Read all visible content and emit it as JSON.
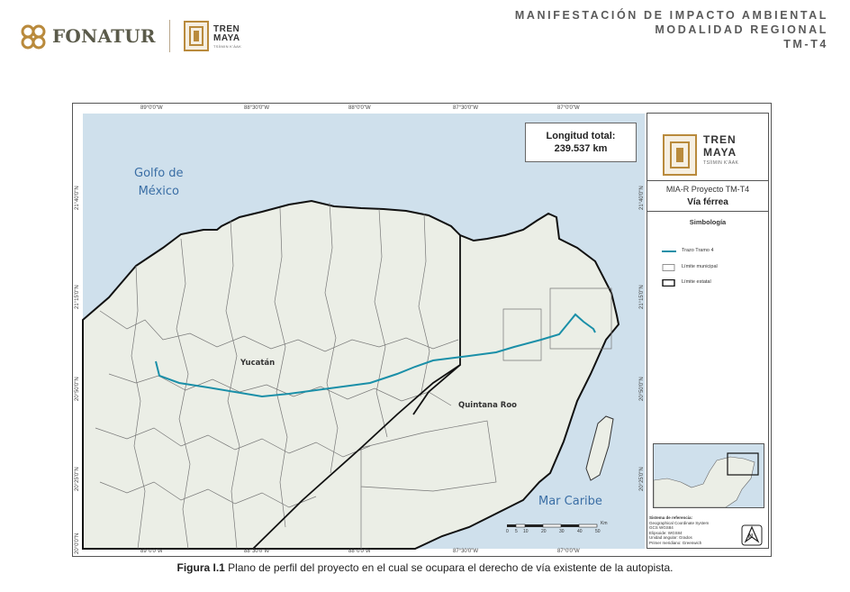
{
  "header": {
    "fonatur": "FONATUR",
    "tren_line1": "TREN",
    "tren_line2": "MAYA",
    "tren_line3": "TSÍIMIN K'ÁAK",
    "title_line1": "MANIFESTACIÓN DE IMPACTO AMBIENTAL",
    "title_line2": "MODALIDAD REGIONAL",
    "title_line3": "TM-T4"
  },
  "map": {
    "longitude_labels": [
      "89°0'0\"W",
      "88°30'0\"W",
      "88°0'0\"W",
      "87°30'0\"W",
      "87°0'0\"W"
    ],
    "latitude_labels": [
      "21°40'0\"N",
      "21°15'0\"N",
      "20°50'0\"N",
      "20°25'0\"N",
      "20°0'0\"N"
    ],
    "total_length_label": "Longitud total:",
    "total_length_value": "239.537 km",
    "gulf_line1": "Golfo de",
    "gulf_line2": "México",
    "caribbean": "Mar Caribe",
    "state_yucatan": "Yucatán",
    "state_qroo": "Quintana Roo",
    "scale_ticks": [
      "0",
      "5",
      "10",
      "20",
      "30",
      "40",
      "50"
    ],
    "scale_unit": "Km",
    "colors": {
      "sea": "#cfe0ec",
      "land": "#ebeee6",
      "route": "#1a8fa8",
      "border": "#111111",
      "municipal": "#777777"
    }
  },
  "legend": {
    "tren_line1": "TREN",
    "tren_line2": "MAYA",
    "tren_line3": "TSÍIMIN K'ÁAK",
    "project": "MIA-R Proyecto TM-T4",
    "subtitle": "Vía férrea",
    "symbology": "Simbología",
    "items": [
      {
        "label": "Trazo Tramo 4",
        "icon": "route-line-icon"
      },
      {
        "label": "Límite municipal",
        "icon": "municipal-box-icon"
      },
      {
        "label": "Límite estatal",
        "icon": "state-box-icon"
      }
    ],
    "ref_title": "Sistema de referencia:",
    "ref_lines": [
      "Geographical Coordinate System",
      "GCS WGS84",
      "Elipsoide: WGS84",
      "Unidad angular: Grados",
      "Primer meridiano: Greenwich"
    ],
    "north": "N"
  },
  "caption": {
    "label": "Figura I.1",
    "text": " Plano de perfil del proyecto en el cual se ocupara el derecho de vía existente de la autopista."
  }
}
